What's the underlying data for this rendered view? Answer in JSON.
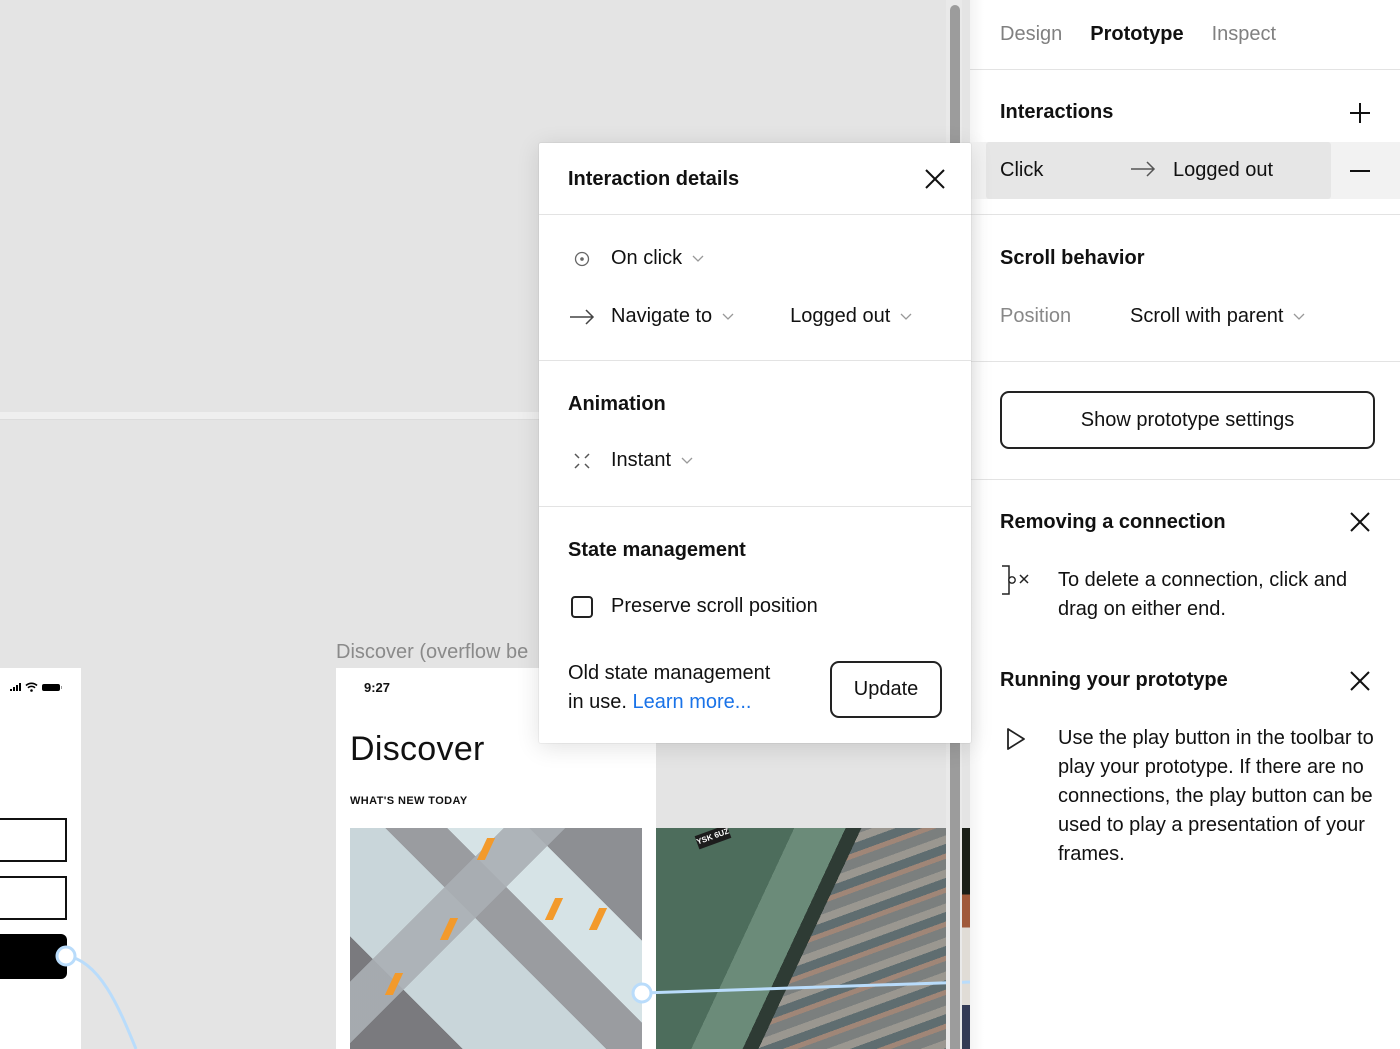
{
  "canvas": {
    "login_frame": {
      "status_icons": [
        "signal-icon",
        "wifi-icon",
        "battery-icon"
      ]
    },
    "discover_frame": {
      "label": "Discover (overflow be",
      "time": "9:27",
      "title": "Discover",
      "subtitle": "WHAT'S NEW TODAY",
      "plate_text": "YSK 6UZ"
    },
    "connector_color": "#b9dcfb"
  },
  "popup": {
    "title": "Interaction details",
    "trigger": {
      "icon": "target-icon",
      "value": "On click"
    },
    "action": {
      "icon": "arrow-right-icon",
      "value": "Navigate to",
      "destination": "Logged out"
    },
    "animation": {
      "heading": "Animation",
      "icon": "instant-icon",
      "value": "Instant"
    },
    "state": {
      "heading": "State management",
      "checkbox_label": "Preserve scroll position",
      "checkbox_checked": false,
      "note_prefix": "Old state management",
      "note_line2": "in use.",
      "learn_more": "Learn more...",
      "update_label": "Update"
    },
    "link_color": "#1a73e8"
  },
  "panel": {
    "tabs": [
      {
        "label": "Design",
        "active": false
      },
      {
        "label": "Prototype",
        "active": true
      },
      {
        "label": "Inspect",
        "active": false
      }
    ],
    "interactions": {
      "heading": "Interactions",
      "items": [
        {
          "trigger": "Click",
          "destination": "Logged out"
        }
      ]
    },
    "scroll_behavior": {
      "heading": "Scroll behavior",
      "position_label": "Position",
      "position_value": "Scroll with parent"
    },
    "settings_button": "Show prototype settings",
    "tips": [
      {
        "title": "Removing a connection",
        "icon": "remove-connection-icon",
        "text": "To delete a connection, click and drag on either end."
      },
      {
        "title": "Running your prototype",
        "icon": "play-icon",
        "text": "Use the play button in the toolbar to play your prototype. If there are no connections, the play button can be used to play a presentation of your frames."
      }
    ]
  }
}
